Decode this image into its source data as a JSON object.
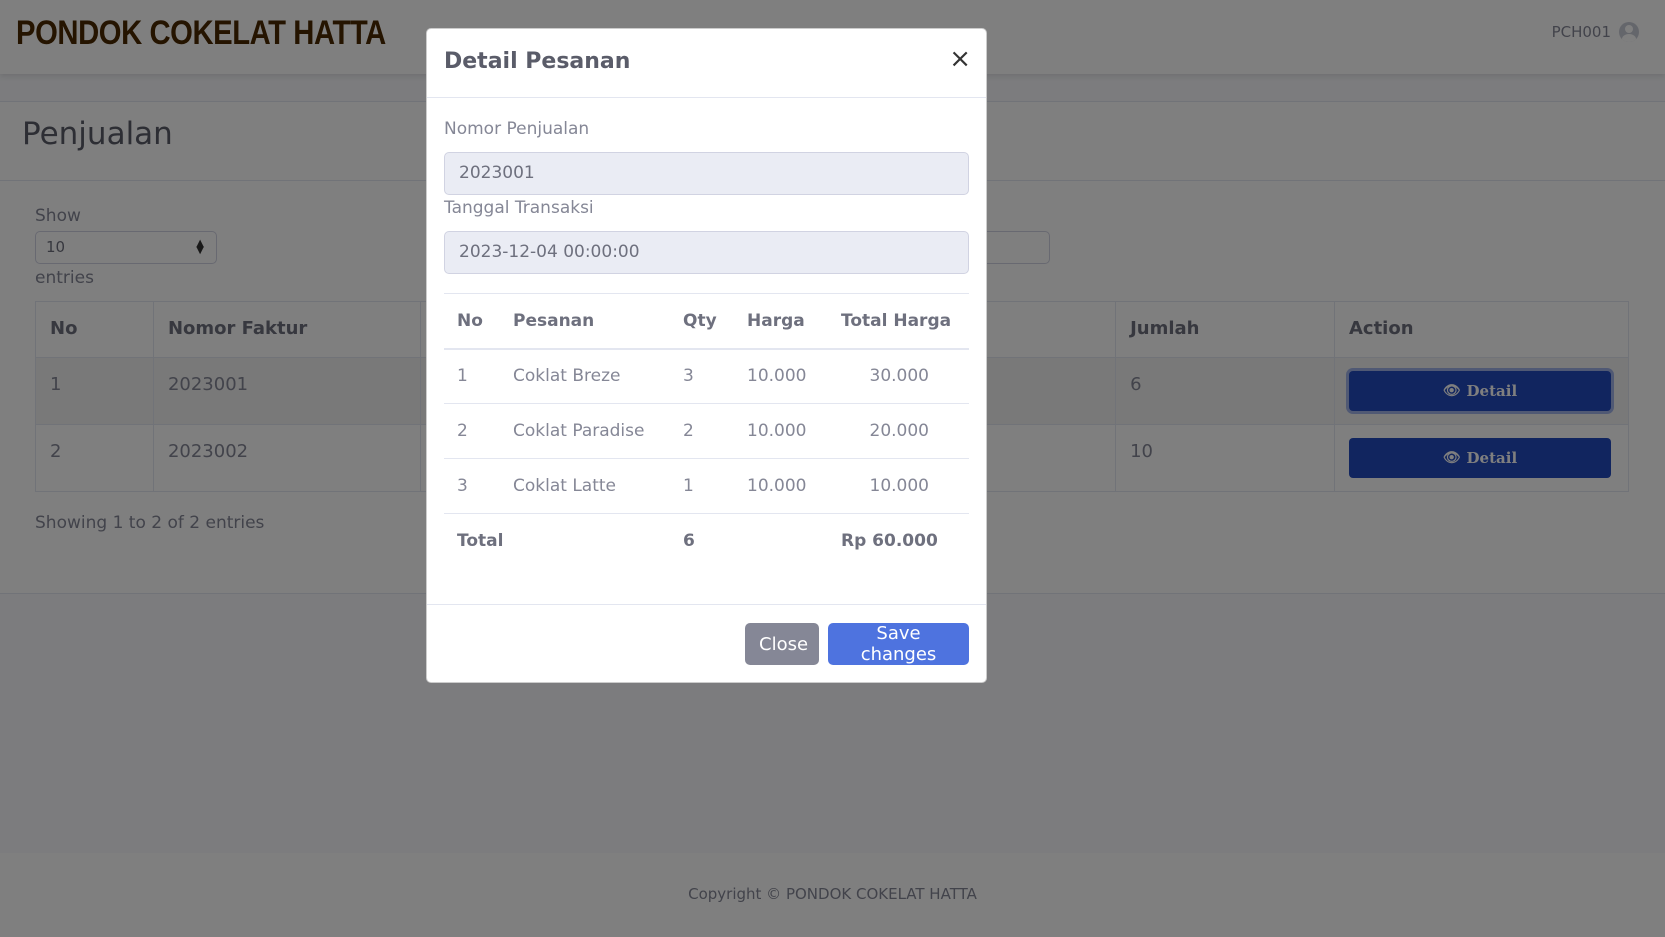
{
  "brand": "PONDOK COKELAT HATTA",
  "user": {
    "name": "PCH001",
    "icon": "user-circle-icon"
  },
  "page": {
    "title": "Penjualan"
  },
  "datatable": {
    "show_label": "Show",
    "page_length": "10",
    "entries_label": "entries",
    "columns": {
      "no": "No",
      "faktur": "Nomor Faktur",
      "jumlah": "Jumlah",
      "action": "Action"
    },
    "rows": [
      {
        "no": "1",
        "faktur": "2023001",
        "jumlah": "6",
        "action": "Detail"
      },
      {
        "no": "2",
        "faktur": "2023002",
        "jumlah": "10",
        "action": "Detail"
      }
    ],
    "info": "Showing 1 to 2 of 2 entries"
  },
  "footer": {
    "copyright": "Copyright © PONDOK COKELAT HATTA"
  },
  "modal": {
    "title": "Detail Pesanan",
    "close_symbol": "×",
    "nomor_label": "Nomor Penjualan",
    "nomor_value": "2023001",
    "tanggal_label": "Tanggal Transaksi",
    "tanggal_value": "2023-12-04 00:00:00",
    "columns": {
      "no": "No",
      "pesanan": "Pesanan",
      "qty": "Qty",
      "harga": "Harga",
      "total": "Total Harga"
    },
    "items": [
      {
        "no": "1",
        "pesanan": "Coklat Breze",
        "qty": "3",
        "harga": "10.000",
        "total": "30.000"
      },
      {
        "no": "2",
        "pesanan": "Coklat Paradise",
        "qty": "2",
        "harga": "10.000",
        "total": "20.000"
      },
      {
        "no": "3",
        "pesanan": "Coklat Latte",
        "qty": "1",
        "harga": "10.000",
        "total": "10.000"
      }
    ],
    "total_row": {
      "label": "Total",
      "qty": "6",
      "amount": "Rp 60.000"
    },
    "close_button": "Close",
    "save_button": "Save changes"
  },
  "colors": {
    "brand": "#4a2800",
    "primary": "#4e73df",
    "detail_button": "#224abe",
    "secondary": "#858796"
  }
}
